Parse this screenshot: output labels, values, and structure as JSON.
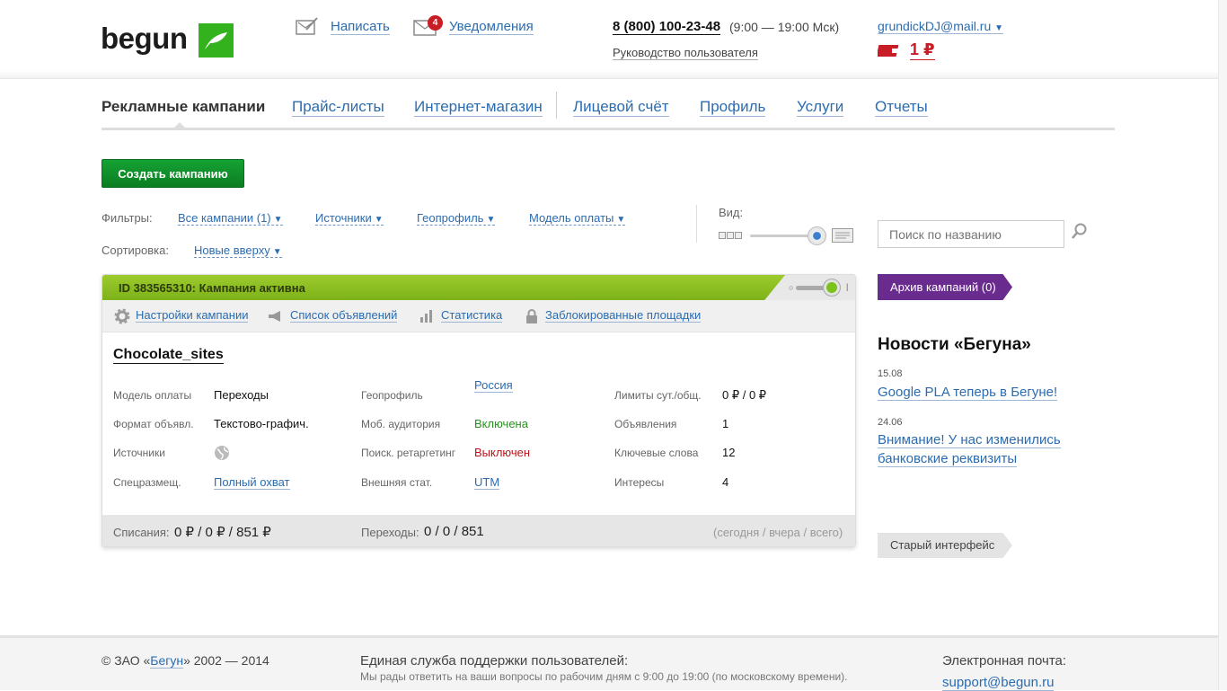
{
  "header": {
    "logo_text": "begun",
    "write_label": "Написать",
    "notifications_label": "Уведомления",
    "notifications_count": "4",
    "phone": "8 (800) 100-23-48",
    "hours": "(9:00 — 19:00 Мск)",
    "manual_label": "Руководство пользователя",
    "account": "grundickDJ@mail.ru",
    "balance": "1 ₽"
  },
  "nav": {
    "items": [
      "Рекламные кампании",
      "Прайс-листы",
      "Интернет-магазин",
      "Лицевой счёт",
      "Профиль",
      "Услуги",
      "Отчеты"
    ]
  },
  "actions": {
    "create_label": "Создать кампанию"
  },
  "filters": {
    "label": "Фильтры:",
    "campaigns": "Все кампании (1)",
    "sources": "Источники",
    "geo": "Геопрофиль",
    "payment": "Модель оплаты",
    "sort_label": "Сортировка:",
    "sort_value": "Новые вверху",
    "view_label": "Вид:"
  },
  "search": {
    "placeholder": "Поиск по названию"
  },
  "campaign": {
    "header": "ID 383565310: Кампания активна",
    "tools": [
      "Настройки кампании",
      "Список объявлений",
      "Статистика",
      "Заблокированные площадки"
    ],
    "name": "Chocolate_sites",
    "params": {
      "payment_model_label": "Модель оплаты",
      "payment_model": "Переходы",
      "ad_format_label": "Формат объявл.",
      "ad_format": "Текстово-графич.",
      "sources_label": "Источники",
      "special_label": "Спецразмещ.",
      "special": "Полный охват",
      "geo_label": "Геопрофиль",
      "geo": "Россия",
      "mobile_label": "Моб. аудитория",
      "mobile": "Включена",
      "retarget_label": "Поиск. ретаргетинг",
      "retarget": "Выключен",
      "ext_stat_label": "Внешняя стат.",
      "ext_stat": "UTM",
      "limits_label": "Лимиты сут./общ.",
      "limits": "0 ₽ / 0 ₽",
      "ads_label": "Объявления",
      "ads": "1",
      "keywords_label": "Ключевые слова",
      "keywords": "12",
      "interests_label": "Интересы",
      "interests": "4"
    },
    "footer": {
      "spend_label": "Списания:",
      "spend": "0 ₽ / 0 ₽ / 851 ₽",
      "clicks_label": "Переходы:",
      "clicks": "0 / 0 / 851",
      "note": "(сегодня / вчера / всего)"
    }
  },
  "sidebar": {
    "archive": "Архив кампаний (0)",
    "news_title": "Новости «Бегуна»",
    "news": [
      {
        "date": "15.08",
        "title": "Google PLA теперь в Бегуне!"
      },
      {
        "date": "24.06",
        "title": "Внимание! У нас изменились банковские реквизиты"
      }
    ],
    "old_interface": "Старый интерфейс"
  },
  "footer": {
    "copyright_prefix": "© ЗАО «",
    "copyright_link": "Бегун",
    "copyright_suffix": "» 2002 — 2014",
    "support_title": "Единая служба поддержки пользователей:",
    "support_text": "Мы рады ответить на ваши вопросы по рабочим дням с 9:00 до 19:00 (по московскому времени).",
    "email_label": "Электронная почта:",
    "email": "support@begun.ru"
  },
  "colors": {
    "brand_green": "#34b21d",
    "link": "#2b6cb0",
    "active_green": "#8cc226",
    "archive_purple": "#6a2b8f",
    "alert_red": "#c81d25"
  }
}
